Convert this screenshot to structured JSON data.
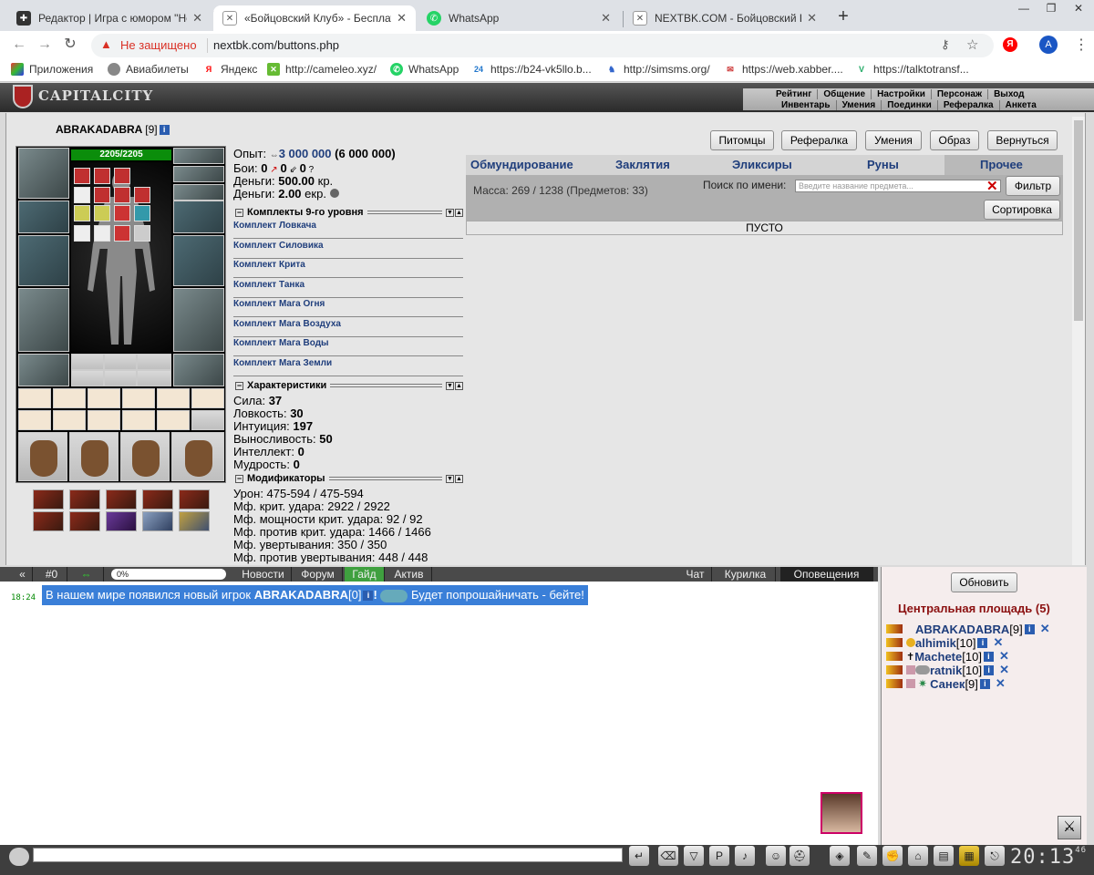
{
  "browser": {
    "tabs": [
      {
        "title": "Редактор | Игра с юмором \"Не",
        "icon": "editor-icon"
      },
      {
        "title": "«Бойцовский Клуб» - Бесплатне",
        "icon": "game-icon"
      },
      {
        "title": "WhatsApp",
        "icon": "whatsapp-icon"
      },
      {
        "title": "NEXTBK.COM - Бойцовский Клу",
        "icon": "game-icon"
      }
    ],
    "security": "Не защищено",
    "url": "nextbk.com/buttons.php",
    "profile_letter": "A",
    "bookmarks": [
      "Приложения",
      "Авиабилеты",
      "Яндекс",
      "http://cameleo.xyz/",
      "WhatsApp",
      "https://b24-vk5llo.b...",
      "http://simsms.org/",
      "https://web.xabber....",
      "https://talktotransf..."
    ]
  },
  "game": {
    "logo": "CAPITALCITY",
    "menu_top": [
      "Рейтинг",
      "Общение",
      "Настройки",
      "Персонаж",
      "Выход"
    ],
    "menu_bottom": [
      "Инвентарь",
      "Умения",
      "Поединки",
      "Рефералка",
      "Анкета"
    ]
  },
  "player": {
    "name": "ABRAKADABRA",
    "level": "[9]",
    "hp": "2205/2205",
    "exp_label": "Опыт:",
    "exp": "3 000 000",
    "exp_next": "(6 000 000)",
    "fights_label": "Бои:",
    "wins": "0",
    "losses": "0",
    "draws": "0",
    "money_label": "Деньги:",
    "money": "500.00",
    "money_unit": "кр.",
    "money2": "2.00",
    "money2_unit": "екр."
  },
  "kits_header": "Комплекты 9-го уровня",
  "kits": [
    "Комплект Ловкача",
    "Комплект Силовика",
    "Комплект Крита",
    "Комплект Танка",
    "Комплект Мага Огня",
    "Комплект Мага Воздуха",
    "Комплект Мага Воды",
    "Комплект Мага Земли"
  ],
  "stats_header": "Характеристики",
  "stats": [
    {
      "label": "Сила:",
      "value": "37"
    },
    {
      "label": "Ловкость:",
      "value": "30"
    },
    {
      "label": "Интуиция:",
      "value": "197"
    },
    {
      "label": "Выносливость:",
      "value": "50"
    },
    {
      "label": "Интеллект:",
      "value": "0"
    },
    {
      "label": "Мудрость:",
      "value": "0"
    }
  ],
  "mods_header": "Модификаторы",
  "mods": [
    "Урон: 475-594 / 475-594",
    "Мф. крит. удара: 2922 / 2922",
    "Мф. мощности крит. удара: 92 / 92",
    "Мф. против крит. удара: 1466 / 1466",
    "Мф. увертывания: 350 / 350",
    "Мф. против увертывания: 448 / 448"
  ],
  "top_buttons": [
    "Питомцы",
    "Рефералка",
    "Умения",
    "Образ",
    "Вернуться"
  ],
  "inventory": {
    "tabs": [
      "Обмундирование",
      "Заклятия",
      "Эликсиры",
      "Руны",
      "Прочее"
    ],
    "mass": "Масса: 269 / 1238 (Предметов: 33)",
    "search_label": "Поиск по имени:",
    "search_placeholder": "Введите название предмета...",
    "filter": "Фильтр",
    "sort": "Сортировка",
    "empty": "ПУСТО"
  },
  "chat": {
    "left_tabs": [
      "«",
      "#0",
      "⇔",
      "0%",
      "Новости",
      "Форум",
      "Гайд",
      "Актив"
    ],
    "right_tabs": [
      "Чат",
      "Курилка",
      "Оповещения"
    ],
    "progress": 0,
    "message_time": "18:24",
    "message_prefix": "В нашем мире появился новый игрок",
    "message_name": "ABRAKADABRA",
    "message_level": "[0]",
    "message_mark": "!",
    "message_suffix": "Будет попрошайничать - бейте!"
  },
  "room": {
    "refresh": "Обновить",
    "title": "Центральная площадь (5)",
    "players": [
      {
        "name": "ABRAKADABRA",
        "level": "[9]"
      },
      {
        "name": "alhimik",
        "level": "[10]"
      },
      {
        "name": "Machete",
        "level": "[10]"
      },
      {
        "name": "ratnik",
        "level": "[10]"
      },
      {
        "name": "Санек",
        "level": "[9]"
      }
    ]
  },
  "clock": {
    "time": "20:13",
    "seconds": "46"
  }
}
